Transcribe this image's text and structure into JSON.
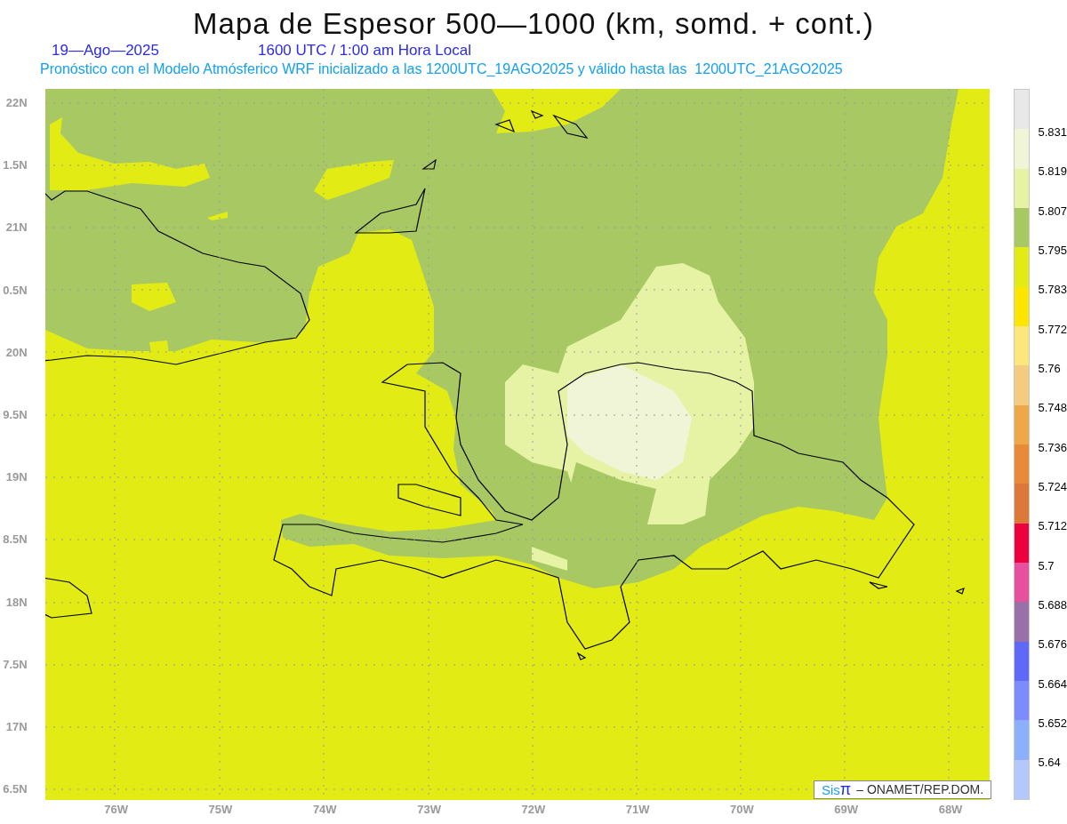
{
  "title": "Mapa de Espesor 500—1000 (km, somd. + cont.)",
  "date": "19—Ago—2025",
  "time": "1600 UTC / 1:00 am Hora Local",
  "subtitle": "Pronóstico con el Modelo Atmósferico WRF inicializado a las 1200UTC_19AGO2025 y válido hasta las  1200UTC_21AGO2025",
  "map": {
    "lat_labels": [
      "22N",
      "1.5N",
      "21N",
      "0.5N",
      "20N",
      "9.5N",
      "19N",
      "8.5N",
      "18N",
      "7.5N",
      "17N",
      "6.5N"
    ],
    "lon_labels": [
      "76W",
      "75W",
      "74W",
      "73W",
      "72W",
      "71W",
      "70W",
      "69W",
      "68W"
    ]
  },
  "colorbar": {
    "segments": [
      {
        "color": "#e8e8e8"
      },
      {
        "color": "#f0f5d8"
      },
      {
        "color": "#e6f3a4"
      },
      {
        "color": "#a8c864"
      },
      {
        "color": "#e2ec14"
      },
      {
        "color": "#fce600"
      },
      {
        "color": "#fde67a"
      },
      {
        "color": "#f4cc80"
      },
      {
        "color": "#eea848"
      },
      {
        "color": "#e88a38"
      },
      {
        "color": "#dc783a"
      },
      {
        "color": "#ee0040"
      },
      {
        "color": "#e6509e"
      },
      {
        "color": "#9a70a8"
      },
      {
        "color": "#6068f8"
      },
      {
        "color": "#7c8cfc"
      },
      {
        "color": "#8cb0fc"
      },
      {
        "color": "#b4c8fc"
      }
    ],
    "labels": [
      "5.831",
      "5.819",
      "5.807",
      "5.795",
      "5.783",
      "5.772",
      "5.76",
      "5.748",
      "5.736",
      "5.724",
      "5.712",
      "5.7",
      "5.688",
      "5.676",
      "5.664",
      "5.652",
      "5.64"
    ]
  },
  "credit": {
    "logo": "Sisπ",
    "text": "– ONAMET/REP.DOM."
  }
}
